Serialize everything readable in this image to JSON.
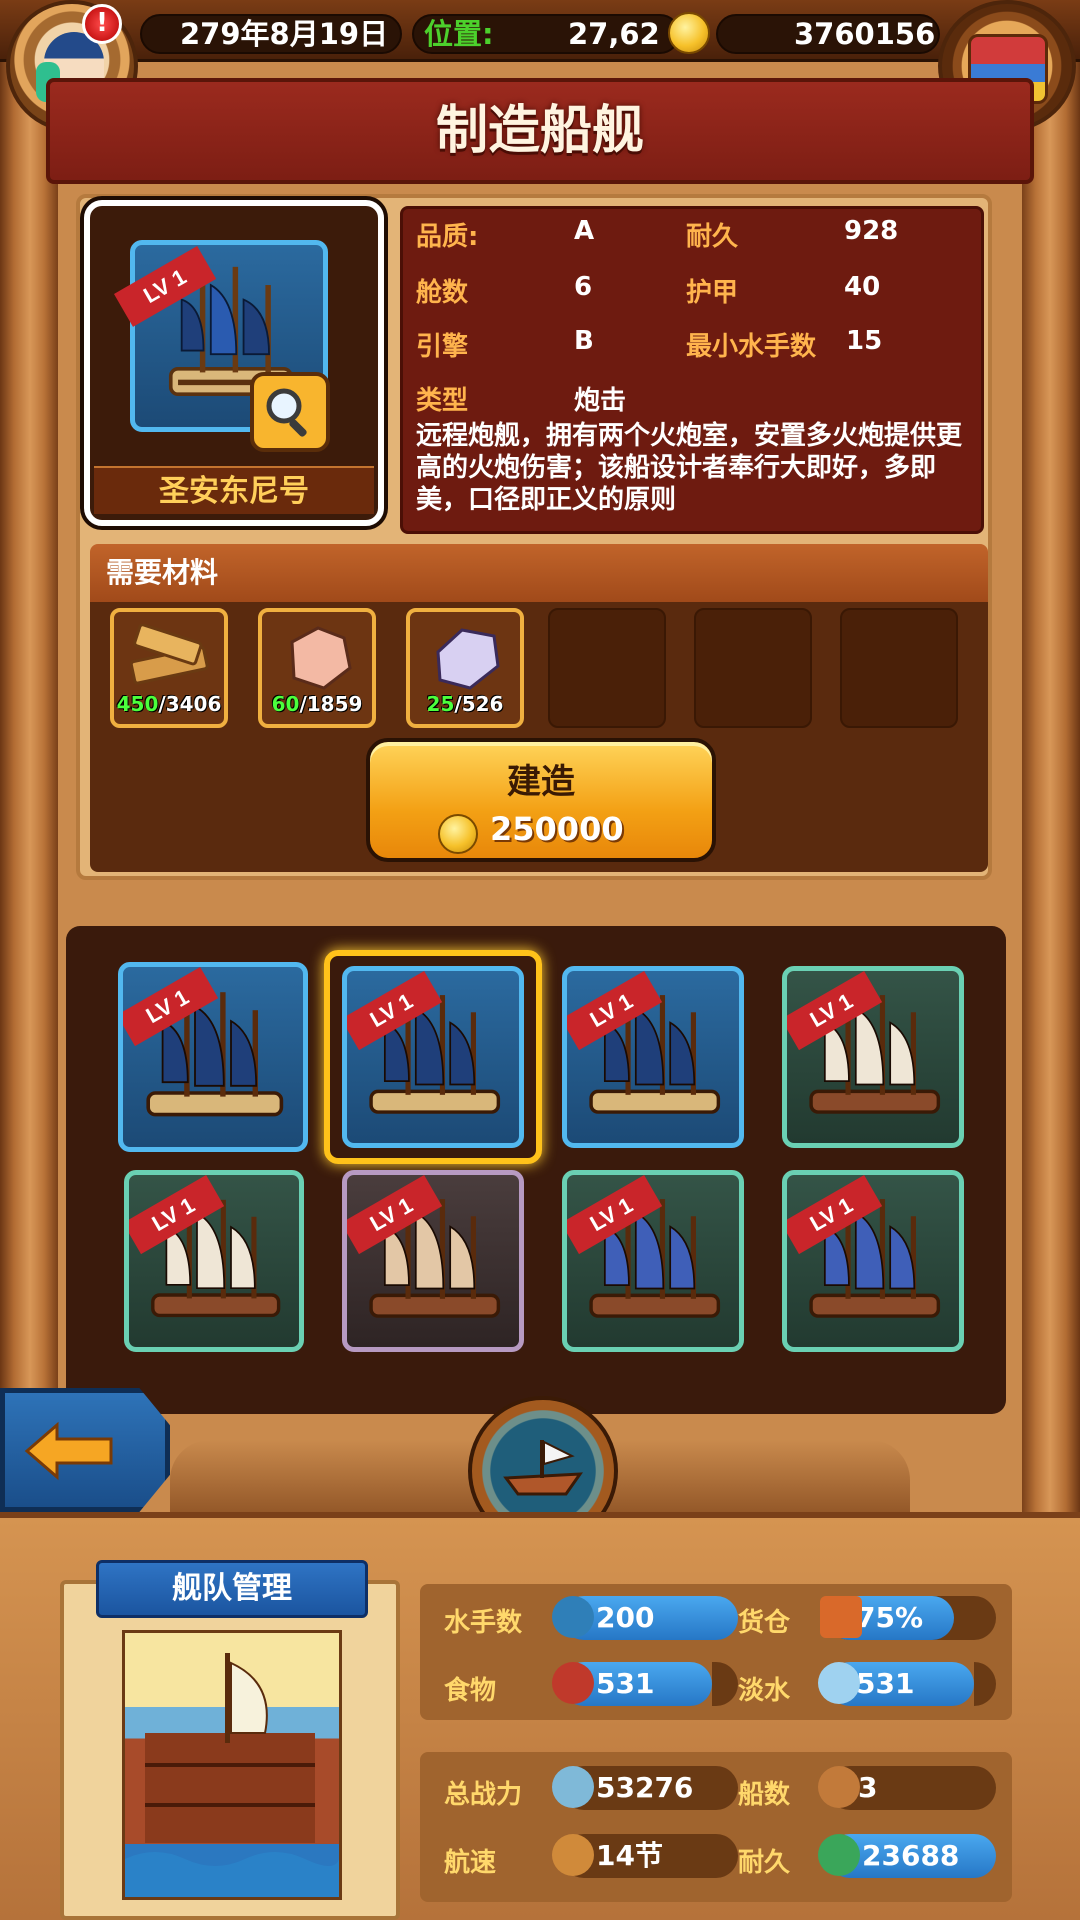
{
  "top_bar": {
    "date": "279年8月19日",
    "position_label": "位置:",
    "position_value": "27,62",
    "gold": "3760156",
    "alert": "!"
  },
  "title": "制造船舰",
  "ship": {
    "level": "LV 1",
    "name": "圣安东尼号",
    "stats": {
      "quality_label": "品质:",
      "quality": "A",
      "durability_label": "耐久",
      "durability": "928",
      "cabins_label": "舱数",
      "cabins": "6",
      "armor_label": "护甲",
      "armor": "40",
      "engine_label": "引擎",
      "engine": "B",
      "min_crew_label": "最小水手数",
      "min_crew": "15",
      "type_label": "类型",
      "type": "炮击"
    },
    "description": "远程炮舰，拥有两个火炮室，安置多火炮提供更高的火炮伤害；该船设计者奉行大即好，多即美，口径即正义的原则"
  },
  "materials": {
    "header": "需要材料",
    "items": [
      {
        "icon": "wood-icon",
        "have": "450",
        "need": "/3406"
      },
      {
        "icon": "pink-ore-icon",
        "have": "60",
        "need": "/1859"
      },
      {
        "icon": "purple-ore-icon",
        "have": "25",
        "need": "/526"
      }
    ]
  },
  "build": {
    "label": "建造",
    "cost": "250000"
  },
  "ship_grid": {
    "level_labels": [
      "LV 1",
      "LV 1",
      "LV 1",
      "LV 1",
      "LV 1",
      "LV 1",
      "LV 1",
      "LV 1"
    ],
    "tiles": [
      {
        "rarity": "blue",
        "ship": "galleon-blue-sails"
      },
      {
        "rarity": "blue",
        "ship": "galleon-blue-sails",
        "selected": true
      },
      {
        "rarity": "blue",
        "ship": "galleon-blue-sails"
      },
      {
        "rarity": "green",
        "ship": "sloop-white-sails"
      },
      {
        "rarity": "green",
        "ship": "sloop-white-sails"
      },
      {
        "rarity": "purple",
        "ship": "caravel-brown"
      },
      {
        "rarity": "green",
        "ship": "junk-blue-sails"
      },
      {
        "rarity": "green",
        "ship": "junk-blue-sails"
      }
    ]
  },
  "fleet": {
    "title": "舰队管理",
    "sailors_label": "水手数",
    "sailors": "200",
    "cargo_label": "货仓",
    "cargo": "75%",
    "food_label": "食物",
    "food": "531",
    "water_label": "淡水",
    "water": "531",
    "power_label": "总战力",
    "power": "53276",
    "ships_label": "船数",
    "ships": "3",
    "speed_label": "航速",
    "speed": "14节",
    "durability_label": "耐久",
    "durability": "23688"
  },
  "colors": {
    "title_red": "#9b2a1e",
    "gold_text": "#ffcf5a",
    "stat_label": "#ffb44d",
    "material_have": "#4cff3c",
    "selected_border": "#ffc21a",
    "tile_blue": "#52b8ef",
    "tile_green": "#6ad0b3",
    "tile_purple": "#b79ac2"
  }
}
